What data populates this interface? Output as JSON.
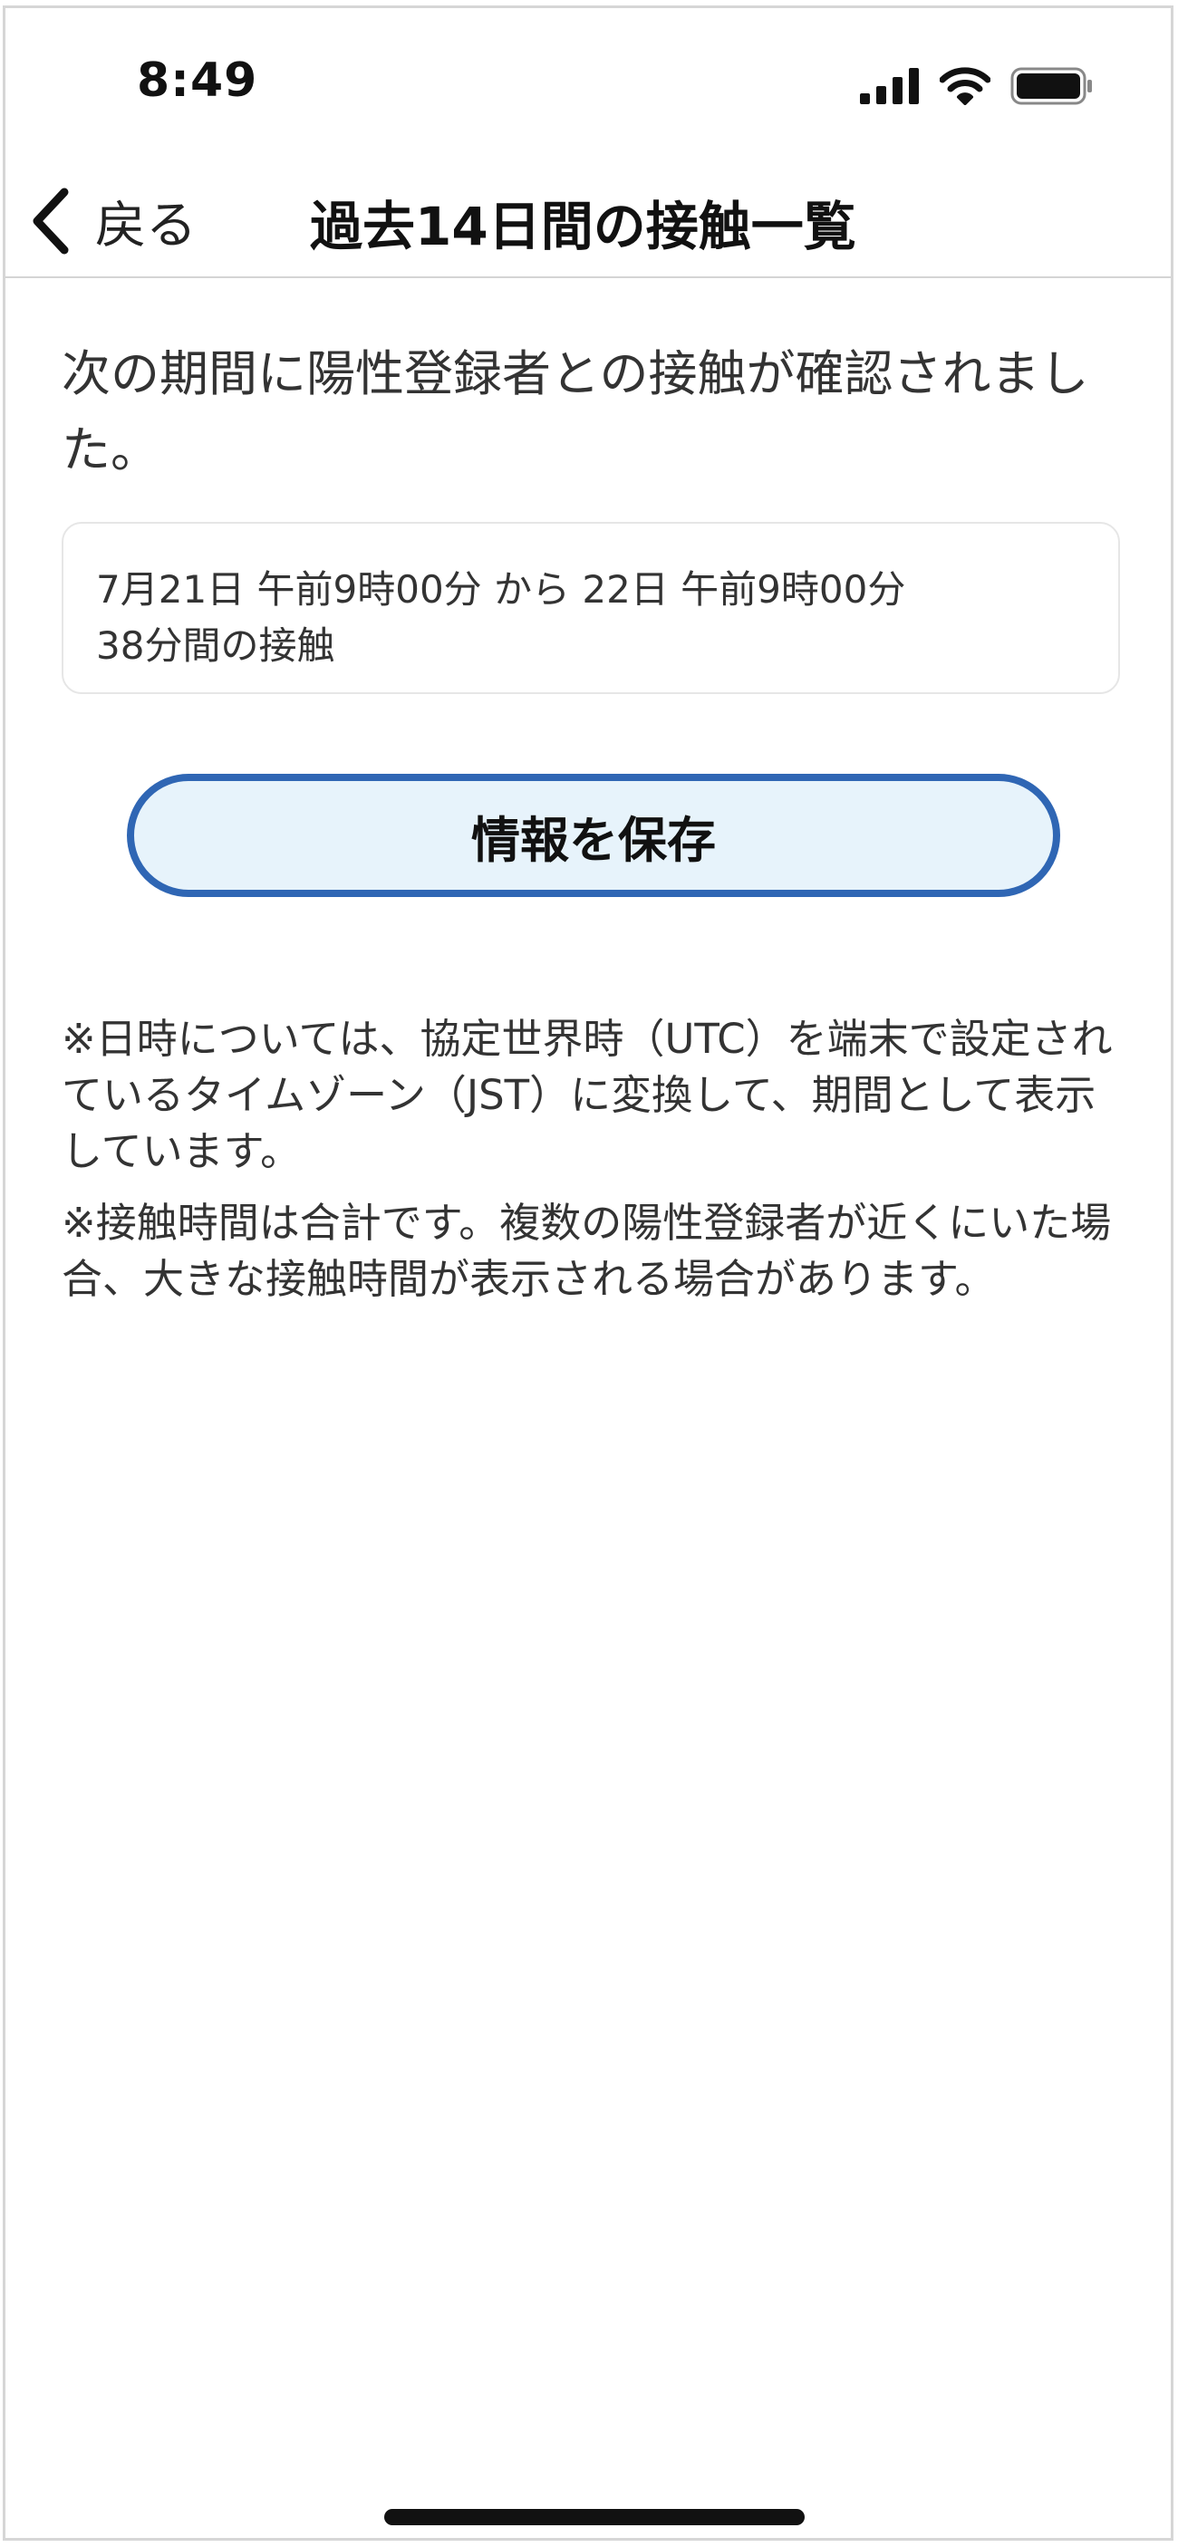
{
  "status_bar": {
    "time": "8:49",
    "icons": [
      "signal-icon",
      "wifi-icon",
      "battery-icon"
    ]
  },
  "nav": {
    "back_label": "戻る",
    "title": "過去14日間の接触一覧"
  },
  "content": {
    "intro": "次の期間に陽性登録者との接触が確認されました。",
    "contact": {
      "period": "7月21日 午前9時00分 から 22日 午前9時00分",
      "duration": "38分間の接触"
    },
    "save_button_label": "情報を保存",
    "note_1": "※日時については、協定世界時（UTC）を端末で設定されているタイムゾーン（JST）に変換して、期間として表示しています。",
    "note_2": "※接触時間は合計です。複数の陽性登録者が近くにいた場合、大きな接触時間が表示される場合があります。"
  },
  "colors": {
    "button_border": "#2f66b4",
    "button_fill": "#e7f3fb",
    "divider": "#d4d4d4"
  }
}
